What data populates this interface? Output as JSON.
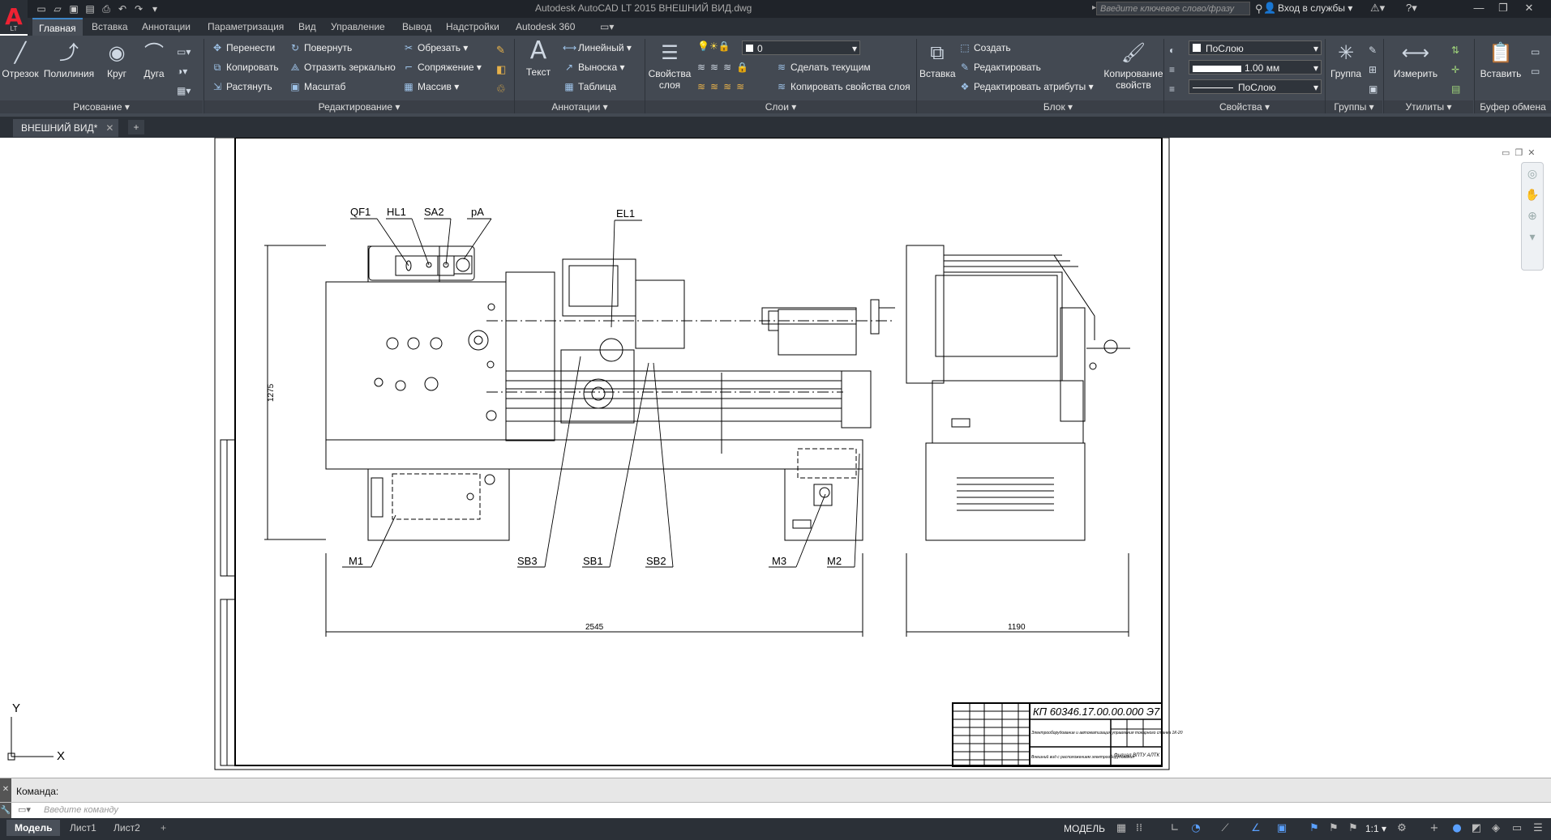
{
  "window": {
    "app_badge": "LT",
    "title": "Autodesk AutoCAD LT 2015    ВНЕШНИЙ ВИД.dwg",
    "search_placeholder": "Введите ключевое слово/фразу",
    "login": "Вход в службы"
  },
  "ribbon_tabs": [
    "Главная",
    "Вставка",
    "Аннотации",
    "Параметризация",
    "Вид",
    "Управление",
    "Вывод",
    "Надстройки",
    "Autodesk 360"
  ],
  "ribbon": {
    "draw": {
      "title": "Рисование",
      "line": "Отрезок",
      "polyline": "Полилиния",
      "circle": "Круг",
      "arc": "Дуга"
    },
    "modify": {
      "title": "Редактирование",
      "move": "Перенести",
      "rotate": "Повернуть",
      "trim": "Обрезать",
      "copy": "Копировать",
      "mirror": "Отразить зеркально",
      "fillet": "Сопряжение",
      "stretch": "Растянуть",
      "scale": "Масштаб",
      "array": "Массив"
    },
    "annotation": {
      "title": "Аннотации",
      "text": "Текст",
      "linear": "Линейный",
      "leader": "Выноска",
      "table": "Таблица"
    },
    "layers": {
      "title": "Слои",
      "properties": "Свойства слоя",
      "current_layer": "0",
      "make_current": "Сделать текущим",
      "match_layer": "Копировать свойства слоя"
    },
    "block": {
      "title": "Блок",
      "insert": "Вставка",
      "create": "Создать",
      "edit": "Редактировать",
      "edit_attr": "Редактировать атрибуты"
    },
    "properties": {
      "title": "Свойства",
      "match": "Копирование свойств",
      "color": "ПоСлою",
      "lineweight": "1.00 мм",
      "linetype": "ПоСлою"
    },
    "groups": {
      "title": "Группы",
      "group": "Группа"
    },
    "utilities": {
      "title": "Утилиты",
      "measure": "Измерить"
    },
    "clipboard": {
      "title": "Буфер обмена",
      "paste": "Вставить"
    }
  },
  "file_tab": "ВНЕШНИЙ ВИД*",
  "drawing": {
    "labels_top": [
      "QF1",
      "HL1",
      "SA2",
      "pA",
      "EL1"
    ],
    "labels_bottom": [
      "M1",
      "SB3",
      "SB1",
      "SB2",
      "M3",
      "M2"
    ],
    "dim_height": "1275",
    "dim_width_front": "2545",
    "dim_width_side": "1190",
    "stamp_code": "КП 60346.17.00.00.000 Э7",
    "stamp_title": "Электрооборудование и автоматизация управления токарного станка 1К-20",
    "stamp_sheet": "Внешний вид с расположением электрооборудования",
    "stamp_org": "Филиал ВПТУ АЛТК",
    "axis_x": "X",
    "axis_y": "Y"
  },
  "command": {
    "history": "Команда:",
    "placeholder": "Введите команду"
  },
  "layout_tabs": [
    "Модель",
    "Лист1",
    "Лист2"
  ],
  "status": {
    "space": "МОДЕЛЬ",
    "scale": "1:1"
  }
}
